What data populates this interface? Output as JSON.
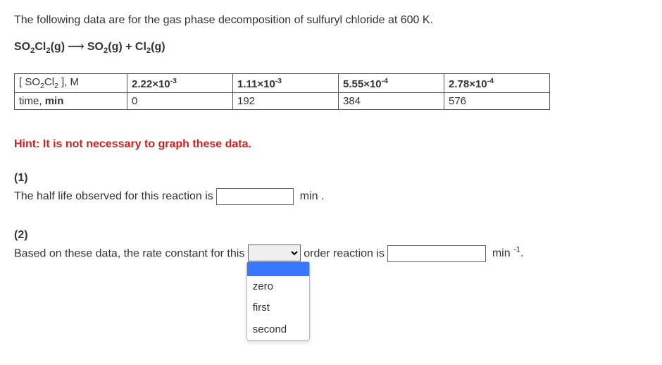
{
  "intro": "The following data are for the gas phase decomposition of sulfuryl chloride at 600 K.",
  "equation": {
    "lhs_html": "SO<span class='sub'>2</span>Cl<span class='sub'>2</span>(g)",
    "arrow": "⟶",
    "rhs_html": "SO<span class='sub'>2</span>(g) + Cl<span class='sub'>2</span>(g)"
  },
  "table": {
    "row1_label_html": "[ SO<span class='sub'>2</span>Cl<span class='sub'>2</span> ], M",
    "row1_vals_html": [
      "2.22×10<span class='sup'>-3</span>",
      "1.11×10<span class='sup'>-3</span>",
      "5.55×10<span class='sup'>-4</span>",
      "2.78×10<span class='sup'>-4</span>"
    ],
    "row2_label_html": "time, <b>min</b>",
    "row2_vals": [
      "0",
      "192",
      "384",
      "576"
    ]
  },
  "hint": "Hint: It is not necessary to graph these data.",
  "part1": {
    "label": "(1)",
    "text_before": "The half life observed for this reaction is ",
    "unit_after": " min ."
  },
  "part2": {
    "label": "(2)",
    "text_before": "Based on these data, the rate constant for this ",
    "text_mid": " order reaction is ",
    "unit_after_html": " min <span class='sup'>-1</span>.",
    "options": [
      "",
      "zero",
      "first",
      "second"
    ],
    "selected": ""
  }
}
